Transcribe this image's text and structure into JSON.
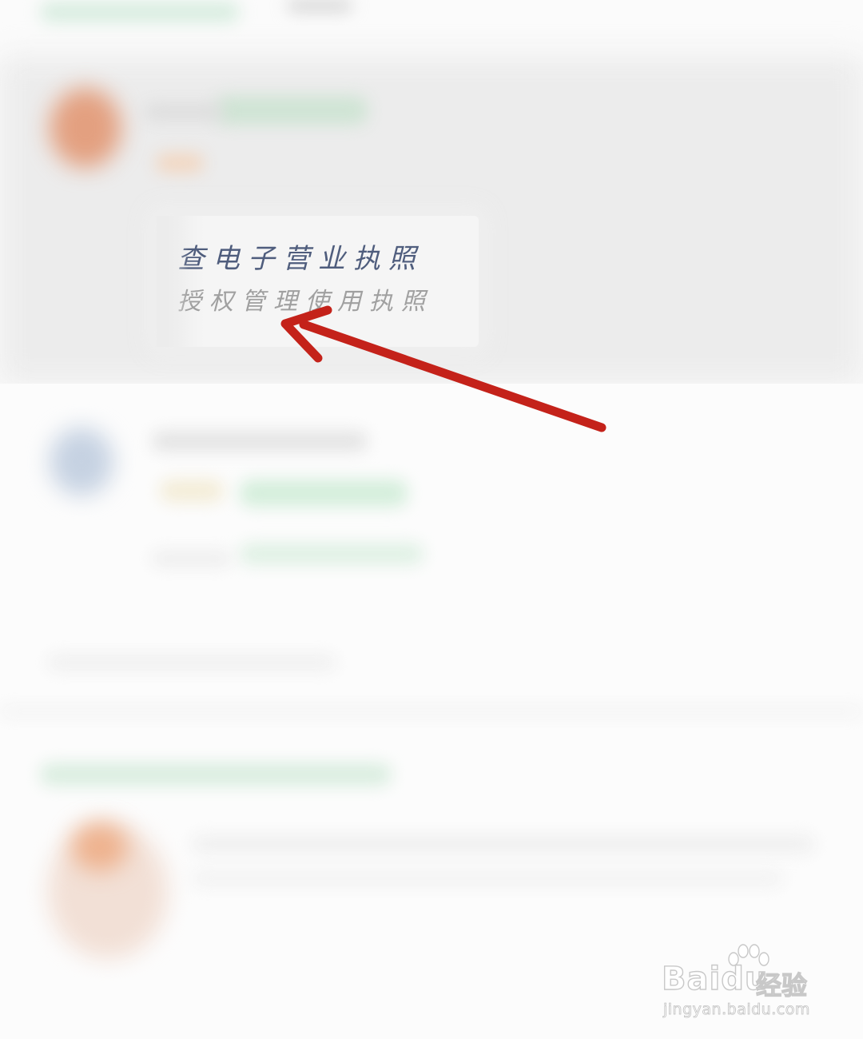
{
  "card": {
    "title": "查电子营业执照",
    "subtitle": "授权管理使用执照"
  },
  "watermark": {
    "logo": "Baidu",
    "cn": "经验",
    "url": "jingyan.baidu.com"
  },
  "colors": {
    "arrow": "#c4221a",
    "title": "#4f5d7d",
    "subtitle": "#a0a0a0",
    "blurred_green": "#cfe9d6",
    "blurred_orange": "#f0b08a",
    "blurred_blue": "#b8c8dc"
  },
  "icons": [
    "pointer-arrow-icon",
    "baidu-paw-icon"
  ]
}
